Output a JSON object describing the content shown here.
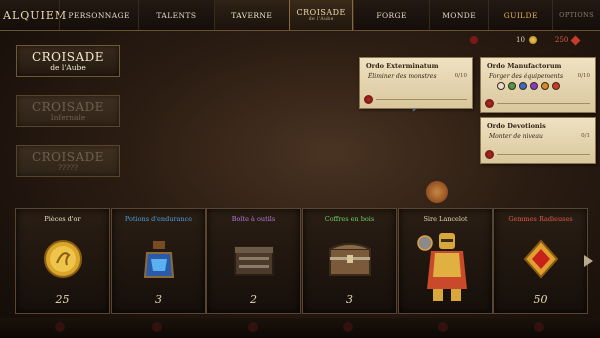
{
  "nav": {
    "brand": "ALQUIEM",
    "tabs": [
      "PERSONNAGE",
      "TALENTS",
      "TAVERNE"
    ],
    "center_title": "CROISADE",
    "center_subtitle": "de l'Aube",
    "tabs_right": [
      "FORGE",
      "MONDE",
      "GUILDE"
    ],
    "options": "OPTIONS"
  },
  "currency": {
    "coins": "10",
    "gems": "250"
  },
  "crusades": [
    {
      "name": "CROISADE",
      "sub": "de l'Aube"
    },
    {
      "name": "CROISADE",
      "sub": "Infernale"
    },
    {
      "name": "CROISADE",
      "sub": "?????"
    }
  ],
  "quests": [
    {
      "title": "Ordo Exterminatum",
      "desc": "Éliminer des monstres",
      "progress": "0/10"
    },
    {
      "title": "Ordo Manufactorum",
      "desc": "Forger des équipements",
      "progress": "0/10"
    },
    {
      "title": "Ordo Devotionis",
      "desc": "Monter de niveau",
      "progress": "0/1"
    }
  ],
  "rewards": [
    {
      "name": "Pièces d'or",
      "count": "25",
      "color": "#efe6d2"
    },
    {
      "name": "Potions d'endurance",
      "count": "3",
      "color": "#4a9ee0"
    },
    {
      "name": "Boîte à outils",
      "count": "2",
      "color": "#b57ae0"
    },
    {
      "name": "Coffres en bois",
      "count": "3",
      "color": "#6fd06a"
    },
    {
      "name": "Sire Lancelot",
      "count": "",
      "color": "#e8d9b5"
    },
    {
      "name": "Gemmes Radieuses",
      "count": "50",
      "color": "#e05a4a"
    }
  ],
  "icons": {
    "coin": "coin-icon",
    "potion": "potion-icon",
    "toolbox": "toolbox-icon",
    "chest": "chest-icon",
    "knight": "knight-icon",
    "gem": "gem-icon"
  }
}
